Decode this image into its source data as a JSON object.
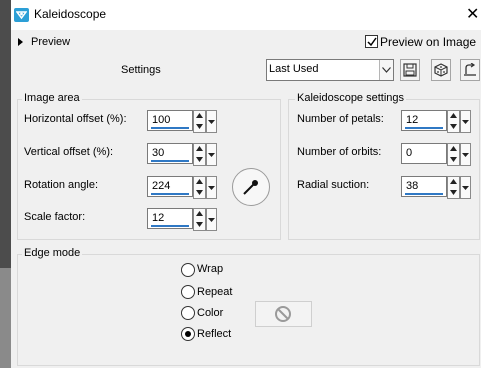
{
  "window": {
    "title": "Kaleidoscope",
    "close_glyph": "✕"
  },
  "preview_toggle": {
    "label": "Preview"
  },
  "preview_on_image": {
    "label": "Preview on Image",
    "checked": true
  },
  "settings": {
    "label": "Settings",
    "preset_value": "Last Used"
  },
  "image_area": {
    "title": "Image area",
    "horizontal_offset": {
      "label": "Horizontal offset (%):",
      "value": "100"
    },
    "vertical_offset": {
      "label": "Vertical offset (%):",
      "value": "30"
    },
    "rotation_angle": {
      "label": "Rotation angle:",
      "value": "224"
    },
    "scale_factor": {
      "label": "Scale factor:",
      "value": "12"
    }
  },
  "kaleidoscope_settings": {
    "title": "Kaleidoscope settings",
    "number_of_petals": {
      "label": "Number of petals:",
      "value": "12"
    },
    "number_of_orbits": {
      "label": "Number of orbits:",
      "value": "0"
    },
    "radial_suction": {
      "label": "Radial suction:",
      "value": "38"
    }
  },
  "edge_mode": {
    "title": "Edge mode",
    "options": [
      {
        "label": "Wrap",
        "selected": false
      },
      {
        "label": "Repeat",
        "selected": false
      },
      {
        "label": "Color",
        "selected": false
      },
      {
        "label": "Reflect",
        "selected": true
      }
    ]
  },
  "icons": [
    "app-icon",
    "close-icon",
    "expand-triangle-icon",
    "checkmark-icon",
    "dropdown-arrow-icon",
    "save-preset-icon",
    "randomize-icon",
    "reset-icon",
    "angle-dial-icon",
    "no-color-icon"
  ],
  "colors": {
    "accent_underline": "#2f78c4",
    "app_icon": "#2c9fd6",
    "dialog_bg": "#f0f0f0"
  }
}
